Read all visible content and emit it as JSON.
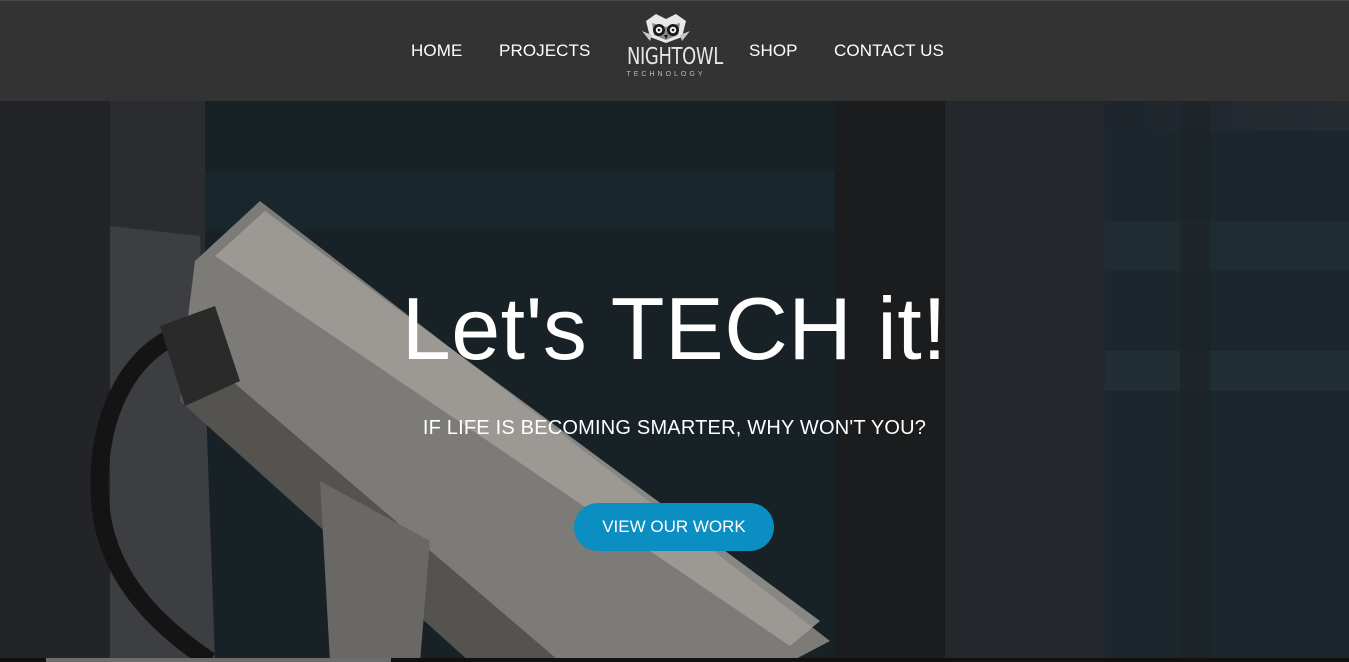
{
  "nav": {
    "items": [
      {
        "label": "HOME"
      },
      {
        "label": "PROJECTS"
      },
      {
        "label": "SHOP"
      },
      {
        "label": "CONTACT US"
      }
    ]
  },
  "logo": {
    "name": "NIGHTOWL",
    "subtitle": "TECHNOLOGY",
    "icon": "owl-logo-icon"
  },
  "hero": {
    "heading": "Let's TECH it!",
    "subheading": "IF LIFE IS BECOMING SMARTER, WHY WON'T YOU?",
    "cta_label": "VIEW OUR WORK",
    "background": "security-camera-photo"
  },
  "colors": {
    "navbar": "#333333",
    "accent": "#0b8ec1",
    "text": "#ffffff"
  }
}
